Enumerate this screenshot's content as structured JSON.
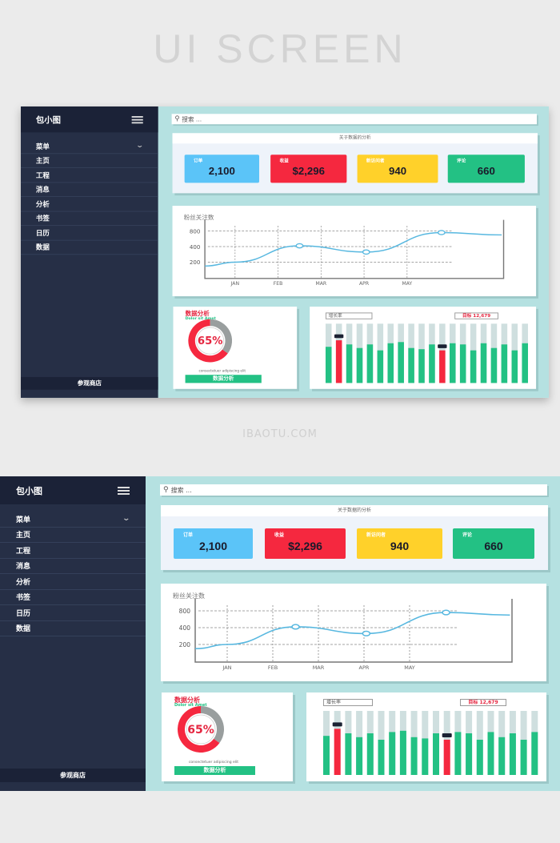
{
  "hero_title": "UI SCREEN",
  "site": "IBAOTU.COM",
  "sidebar": {
    "brand": "包小图",
    "items": [
      {
        "label": "菜单"
      },
      {
        "label": "主页"
      },
      {
        "label": "工程"
      },
      {
        "label": "消息"
      },
      {
        "label": "分析"
      },
      {
        "label": "书签"
      },
      {
        "label": "日历"
      },
      {
        "label": "数据"
      }
    ],
    "footer": "参观商店"
  },
  "search": {
    "placeholder": "搜索 ..."
  },
  "stats": {
    "title": "关于数据的分析",
    "cards": [
      {
        "label": "订单",
        "value": "2,100",
        "color": "#5bc4f8"
      },
      {
        "label": "收益",
        "value": "$2,296",
        "color": "#f5283f"
      },
      {
        "label": "新访问者",
        "value": "940",
        "color": "#ffd12a"
      },
      {
        "label": "评论",
        "value": "660",
        "color": "#23c184"
      }
    ]
  },
  "chart_data": [
    {
      "type": "line",
      "title": "粉丝关注数",
      "categories": [
        "JAN",
        "FEB",
        "MAR",
        "APR",
        "MAY"
      ],
      "yticks": [
        800,
        400,
        200
      ],
      "grid": true,
      "line_color": "#58b8e0",
      "points": [
        {
          "x": 0.3,
          "y": 150
        },
        {
          "x": 1,
          "y": 200
        },
        {
          "x": 2.5,
          "y": 420,
          "marker": true
        },
        {
          "x": 4.05,
          "y": 330,
          "marker": true
        },
        {
          "x": 5.8,
          "y": 760,
          "marker": true
        },
        {
          "x": 7.2,
          "y": 700
        }
      ]
    },
    {
      "type": "pie",
      "title": "数据分析",
      "subtitle": "Dolor sit Amet",
      "value_label": "65%",
      "value": 65,
      "caption": "consectetuer adipiscing elit",
      "button": "数据分析",
      "colors": [
        "#f5283f",
        "#999e9e"
      ]
    },
    {
      "type": "bar",
      "title": "增长率",
      "target_label": "目标 12,679",
      "ylim": [
        0,
        1
      ],
      "values": [
        0.61,
        0.72,
        0.65,
        0.59,
        0.65,
        0.55,
        0.67,
        0.69,
        0.59,
        0.57,
        0.65,
        0.55,
        0.67,
        0.65,
        0.55,
        0.67,
        0.59,
        0.65,
        0.55,
        0.67
      ],
      "highlight": [
        1,
        11
      ],
      "colors": {
        "bar": "#23c184",
        "highlight": "#f5283f",
        "track": "#cfdfdf"
      }
    }
  ]
}
